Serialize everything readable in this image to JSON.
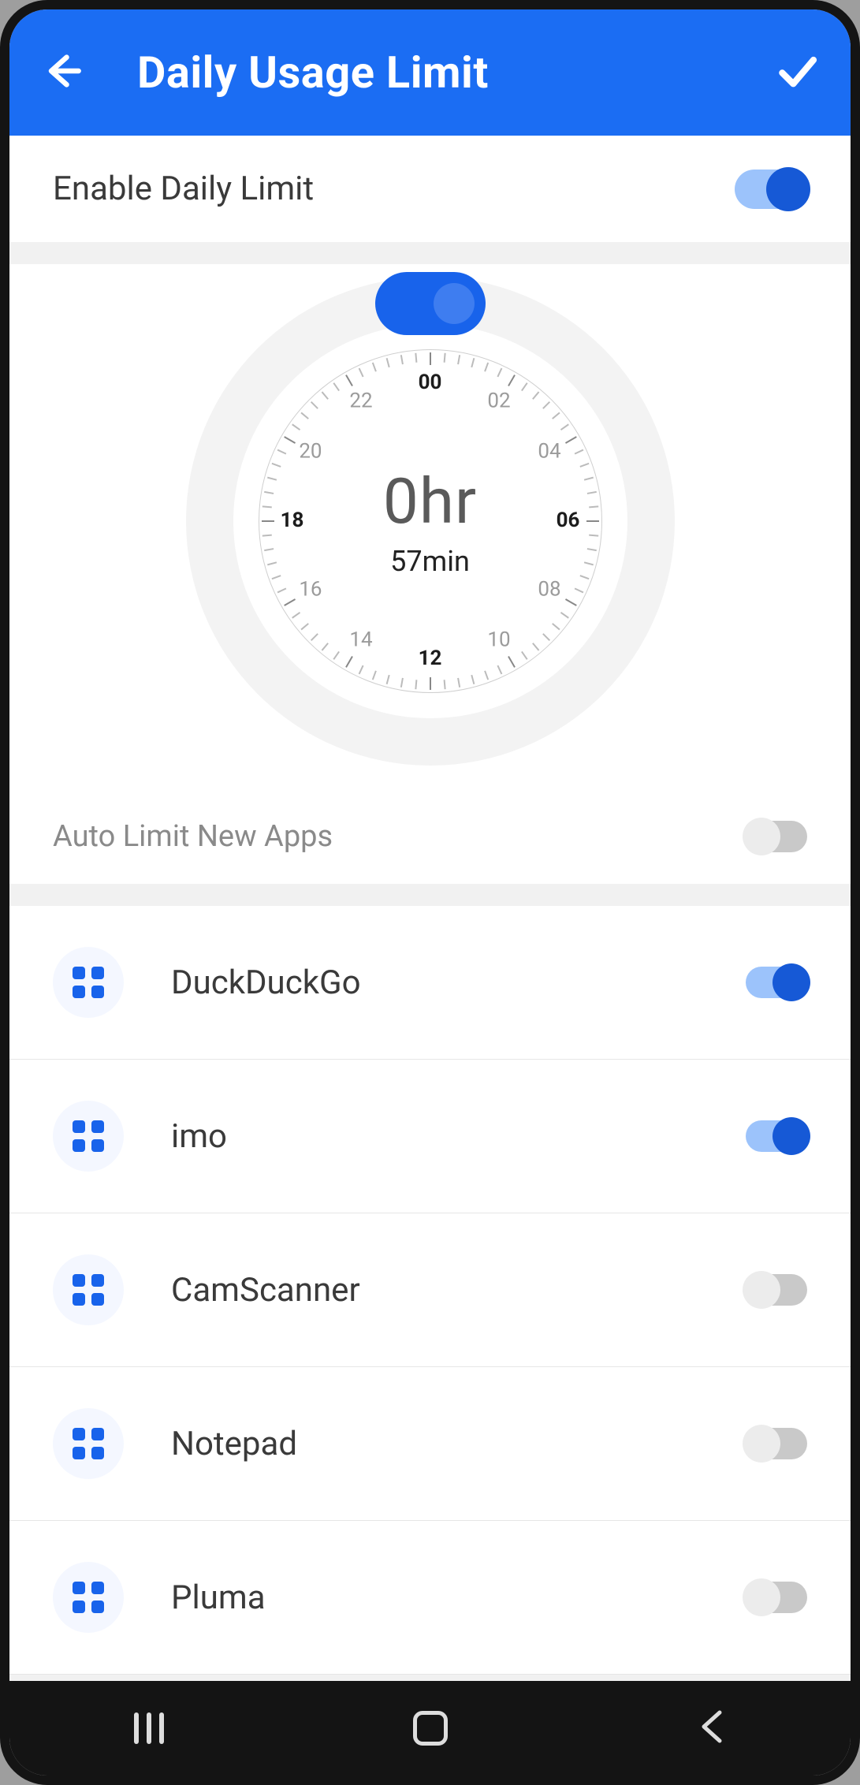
{
  "header": {
    "title": "Daily Usage Limit"
  },
  "enable": {
    "label": "Enable Daily Limit",
    "on": true
  },
  "clock": {
    "hoursLabel": "0hr",
    "minutesLabel": "57min",
    "numbers": [
      "00",
      "02",
      "04",
      "06",
      "08",
      "10",
      "12",
      "14",
      "16",
      "18",
      "20",
      "22"
    ],
    "bold": [
      "00",
      "06",
      "12",
      "18"
    ]
  },
  "autoLimit": {
    "label": "Auto Limit New Apps",
    "on": false
  },
  "apps": [
    {
      "name": "DuckDuckGo",
      "on": true
    },
    {
      "name": "imo",
      "on": true
    },
    {
      "name": "CamScanner",
      "on": false
    },
    {
      "name": "Notepad",
      "on": false
    },
    {
      "name": "Pluma",
      "on": false
    }
  ]
}
